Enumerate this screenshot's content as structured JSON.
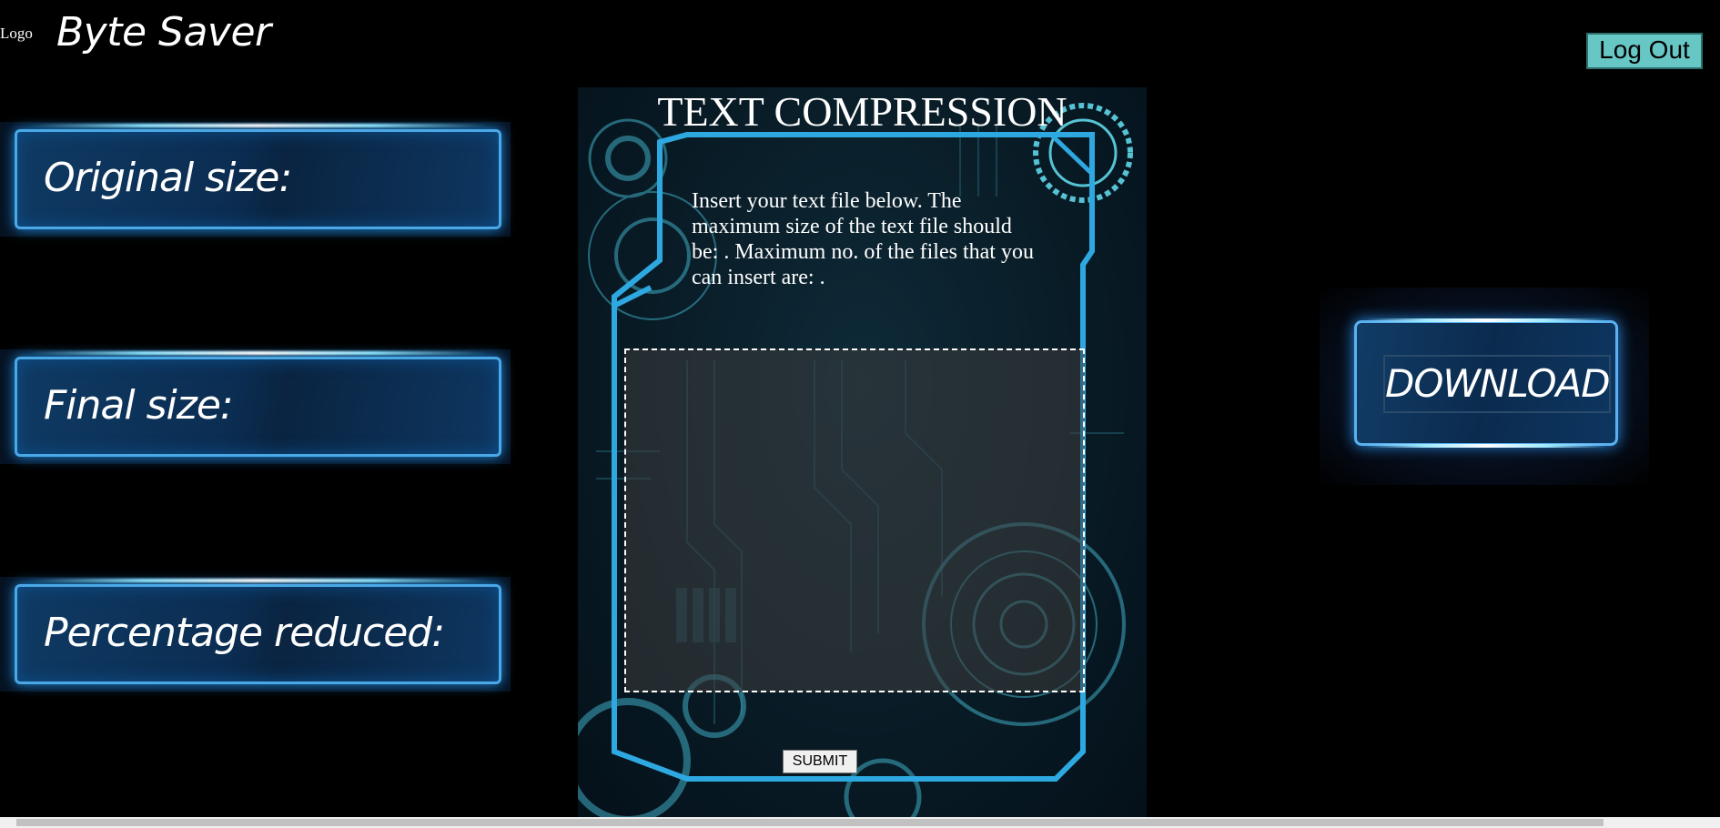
{
  "header": {
    "logo_alt": "Logo",
    "brand": "Byte Saver",
    "logout_label": "Log Out"
  },
  "stats": {
    "original_size_label": "Original size:",
    "final_size_label": "Final size:",
    "percentage_reduced_label": "Percentage reduced:"
  },
  "compression": {
    "title": "TEXT COMPRESSION",
    "instructions": "Insert your text file below. The maximum size of the text file should be: . Maximum no. of the files that you can insert are: .",
    "submit_label": "SUBMIT"
  },
  "download": {
    "label": "DOWNLOAD"
  },
  "colors": {
    "accent_cyan": "#2ec4e8",
    "logout_bg": "#67c7c5",
    "background": "#000000"
  }
}
